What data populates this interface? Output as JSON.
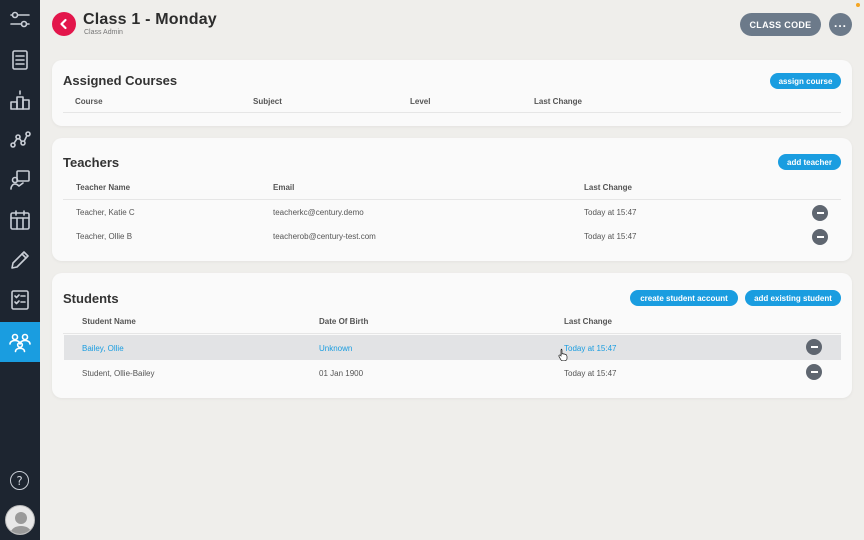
{
  "sidebar": {
    "items": [
      {
        "icon": "sliders-icon",
        "active": false
      },
      {
        "icon": "list-icon",
        "active": false
      },
      {
        "icon": "podium-icon",
        "active": false
      },
      {
        "icon": "network-icon",
        "active": false
      },
      {
        "icon": "presentation-icon",
        "active": false
      },
      {
        "icon": "calendar-icon",
        "active": false
      },
      {
        "icon": "pencil-icon",
        "active": false
      },
      {
        "icon": "checklist-icon",
        "active": false
      },
      {
        "icon": "users-icon",
        "active": true
      }
    ],
    "help_label": "?"
  },
  "header": {
    "title": "Class 1 - Monday",
    "subtitle": "Class Admin",
    "class_code_label": "CLASS CODE",
    "more_label": "..."
  },
  "courses": {
    "title": "Assigned Courses",
    "action_label": "assign course",
    "columns": [
      "Course",
      "Subject",
      "Level",
      "Last Change"
    ]
  },
  "teachers": {
    "title": "Teachers",
    "action_label": "add teacher",
    "columns": [
      "Teacher Name",
      "Email",
      "Last Change"
    ],
    "rows": [
      {
        "name": "Teacher, Katie C",
        "email": "teacherkc@century.demo",
        "last_change": "Today at 15:47"
      },
      {
        "name": "Teacher, Ollie B",
        "email": "teacherob@century-test.com",
        "last_change": "Today at 15:47"
      }
    ]
  },
  "students": {
    "title": "Students",
    "create_label": "create student account",
    "add_label": "add existing student",
    "columns": [
      "Student Name",
      "Date Of Birth",
      "Last Change"
    ],
    "rows": [
      {
        "name": "Bailey, Ollie",
        "dob": "Unknown",
        "last_change": "Today at 15:47",
        "highlighted": true
      },
      {
        "name": "Student, Ollie-Bailey",
        "dob": "01 Jan 1900",
        "last_change": "Today at 15:47",
        "highlighted": false
      }
    ]
  },
  "colors": {
    "accent": "#1a9de0",
    "back_button": "#e3164b",
    "sidebar": "#1d2530",
    "header_buttons": "#6c7a8a"
  }
}
